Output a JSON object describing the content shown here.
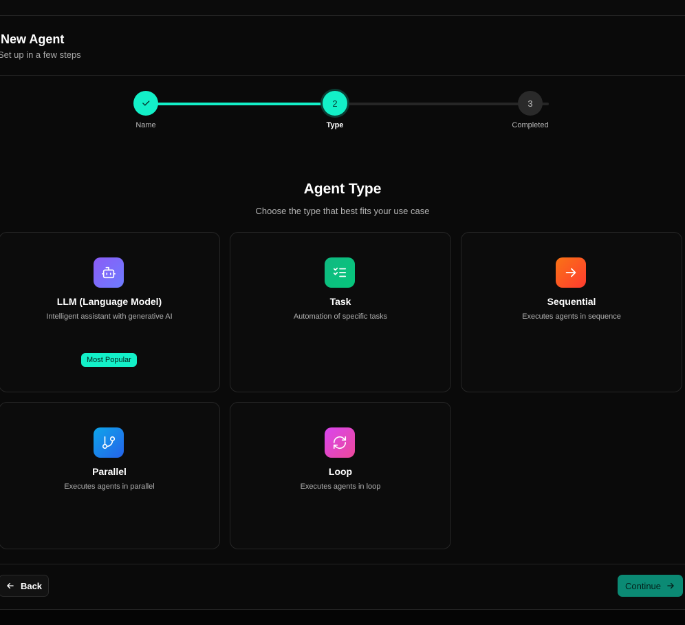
{
  "header": {
    "title": "New Agent",
    "subtitle": "Set up in a few steps"
  },
  "stepper": {
    "steps": [
      {
        "number": "1",
        "label": "Name",
        "state": "completed"
      },
      {
        "number": "2",
        "label": "Type",
        "state": "current"
      },
      {
        "number": "3",
        "label": "Completed",
        "state": "pending"
      }
    ],
    "progress_fraction": 0.5
  },
  "section": {
    "title": "Agent Type",
    "subtitle": "Choose the type that best fits your use case"
  },
  "cards": [
    {
      "name": "LLM (Language Model)",
      "description": "Intelligent assistant with generative AI",
      "icon": "bot-icon",
      "badge": "Most Popular",
      "color_start": "#8b5cf6",
      "color_end": "#6d7cff"
    },
    {
      "name": "Task",
      "description": "Automation of specific tasks",
      "icon": "checklist-icon",
      "color_start": "#10b981",
      "color_end": "#06c77c"
    },
    {
      "name": "Sequential",
      "description": "Executes agents in sequence",
      "icon": "arrow-right-icon",
      "color_start": "#f97316",
      "color_end": "#ff3b2f"
    },
    {
      "name": "Parallel",
      "description": "Executes agents in parallel",
      "icon": "git-branch-icon",
      "color_start": "#0ea5e9",
      "color_end": "#2563eb"
    },
    {
      "name": "Loop",
      "description": "Executes agents in loop",
      "icon": "refresh-icon",
      "color_start": "#d946ef",
      "color_end": "#ec4899"
    }
  ],
  "footer": {
    "back_label": "Back",
    "continue_label": "Continue"
  },
  "colors": {
    "accent": "#13f0c8",
    "background": "#0a0a0a"
  }
}
